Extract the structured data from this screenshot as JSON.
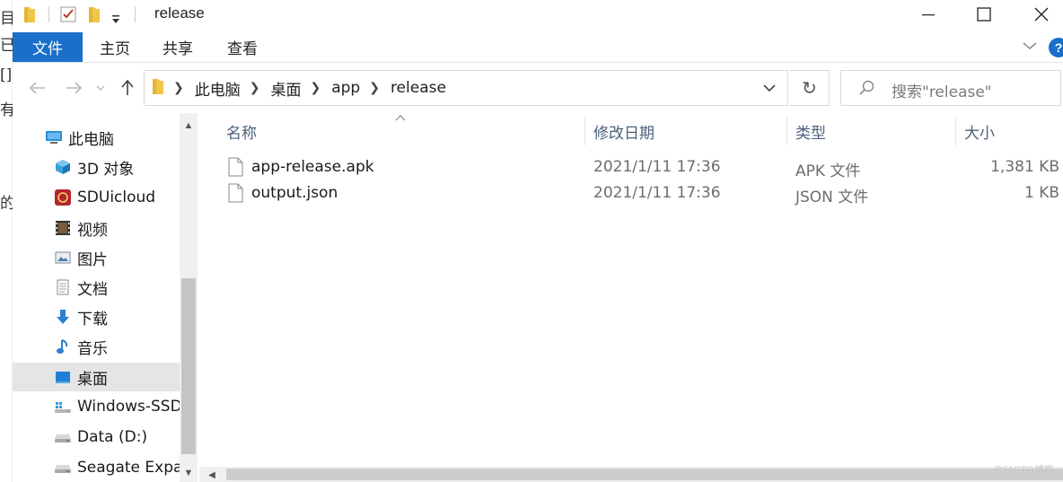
{
  "window": {
    "title": "release"
  },
  "background_window_glyphs": [
    "目",
    "已",
    "有",
    "的",
    "[]"
  ],
  "ribbon": {
    "tabs": [
      "文件",
      "主页",
      "共享",
      "查看"
    ]
  },
  "navigation": {
    "back_icon": "arrow-left-icon",
    "forward_icon": "arrow-right-icon",
    "recent_icon": "chevron-down-icon",
    "up_icon": "arrow-up-icon",
    "breadcrumb": [
      "此电脑",
      "桌面",
      "app",
      "release"
    ],
    "search_placeholder": "搜索\"release\""
  },
  "nav_pane": {
    "items": [
      {
        "label": "此电脑",
        "icon": "pc-icon",
        "level": 1
      },
      {
        "label": "3D 对象",
        "icon": "cube-3d-icon",
        "level": 2
      },
      {
        "label": "SDUicloud",
        "icon": "cloud-app-icon",
        "level": 2
      },
      {
        "label": "视频",
        "icon": "video-icon",
        "level": 2
      },
      {
        "label": "图片",
        "icon": "pictures-icon",
        "level": 2
      },
      {
        "label": "文档",
        "icon": "documents-icon",
        "level": 2
      },
      {
        "label": "下载",
        "icon": "download-icon",
        "level": 2
      },
      {
        "label": "音乐",
        "icon": "music-icon",
        "level": 2
      },
      {
        "label": "桌面",
        "icon": "desktop-icon",
        "level": 2,
        "selected": true
      },
      {
        "label": "Windows-SSD",
        "icon": "drive-windows-icon",
        "level": 2
      },
      {
        "label": "Data (D:)",
        "icon": "drive-icon",
        "level": 2
      },
      {
        "label": "Seagate Expar",
        "icon": "drive-icon",
        "level": 2
      }
    ]
  },
  "file_list": {
    "columns": [
      "名称",
      "修改日期",
      "类型",
      "大小"
    ],
    "rows": [
      {
        "name": "app-release.apk",
        "date": "2021/1/11 17:36",
        "type": "APK 文件",
        "size": "1,381 KB"
      },
      {
        "name": "output.json",
        "date": "2021/1/11 17:36",
        "type": "JSON 文件",
        "size": "1 KB"
      }
    ]
  },
  "colors": {
    "accent": "#1a6fc9",
    "selection": "#e5e5e5",
    "header_text": "#4c607a"
  },
  "watermark": "@51CTO博客"
}
